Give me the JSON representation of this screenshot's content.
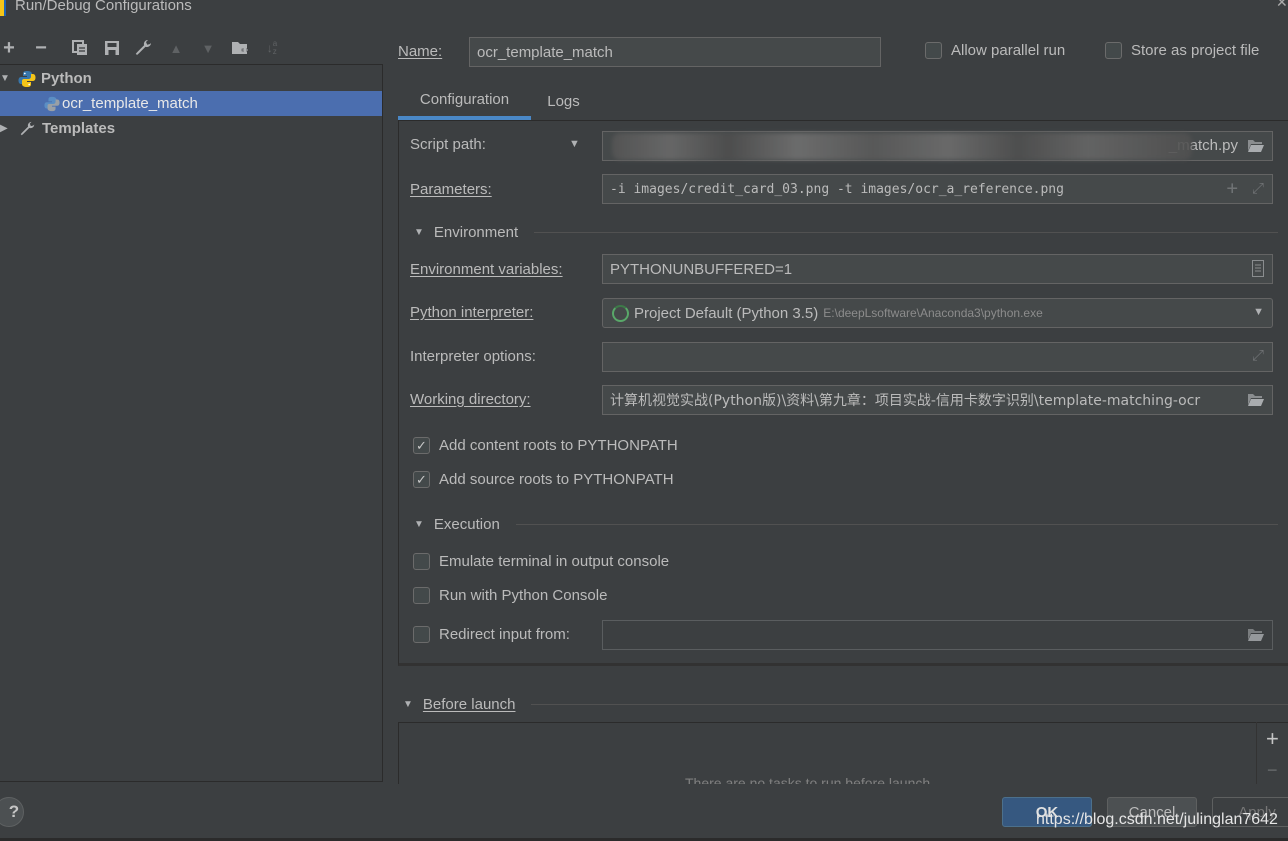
{
  "window": {
    "title": "Run/Debug Configurations"
  },
  "toolbar": {
    "icons": [
      "add-icon",
      "remove-icon",
      "copy-icon",
      "save-icon",
      "wrench-icon",
      "move-up-icon",
      "move-down-icon",
      "new-folder-icon",
      "sort-icon"
    ]
  },
  "tree": {
    "items": [
      {
        "label": "Python",
        "icon": "python-icon",
        "expanded": true,
        "level": 0
      },
      {
        "label": "ocr_template_match",
        "icon": "python-file-icon",
        "selected": true,
        "level": 1
      },
      {
        "label": "Templates",
        "icon": "wrench-icon",
        "expanded": false,
        "level": 0
      }
    ]
  },
  "header": {
    "name_label": "Name:",
    "name_value": "ocr_template_match",
    "allow_parallel_run": {
      "label": "Allow parallel run",
      "checked": false
    },
    "store_as_project_file": {
      "label": "Store as project file",
      "checked": false
    }
  },
  "tabs": [
    {
      "label": "Configuration",
      "active": true
    },
    {
      "label": "Logs",
      "active": false
    }
  ],
  "config": {
    "script_path": {
      "label": "Script path:",
      "value_suffix": "_match.py"
    },
    "parameters": {
      "label": "Parameters:",
      "value": "-i images/credit_card_03.png -t images/ocr_a_reference.png"
    },
    "environment_section": "Environment",
    "env_vars": {
      "label": "Environment variables:",
      "value": "PYTHONUNBUFFERED=1"
    },
    "interpreter": {
      "label": "Python interpreter:",
      "value": "Project Default (Python 3.5)",
      "path": "E:\\deepLsoftware\\Anaconda3\\python.exe"
    },
    "interpreter_options": {
      "label": "Interpreter options:",
      "value": ""
    },
    "working_dir": {
      "label": "Working directory:",
      "value": "计算机视觉实战(Python版)\\资料\\第九章：项目实战-信用卡数字识别\\template-matching-ocr"
    },
    "add_content_roots": {
      "label": "Add content roots to PYTHONPATH",
      "checked": true
    },
    "add_source_roots": {
      "label": "Add source roots to PYTHONPATH",
      "checked": true
    },
    "execution_section": "Execution",
    "emulate_terminal": {
      "label": "Emulate terminal in output console",
      "checked": false
    },
    "run_with_console": {
      "label": "Run with Python Console",
      "checked": false
    },
    "redirect_input": {
      "label": "Redirect input from:",
      "checked": false,
      "value": ""
    }
  },
  "before_launch": {
    "label": "Before launch",
    "empty_text": "There are no tasks to run before launch"
  },
  "buttons": {
    "help": "?",
    "ok": "OK",
    "cancel": "Cancel",
    "apply": "Apply"
  },
  "watermark": "https://blog.csdn.net/julinglan7642"
}
